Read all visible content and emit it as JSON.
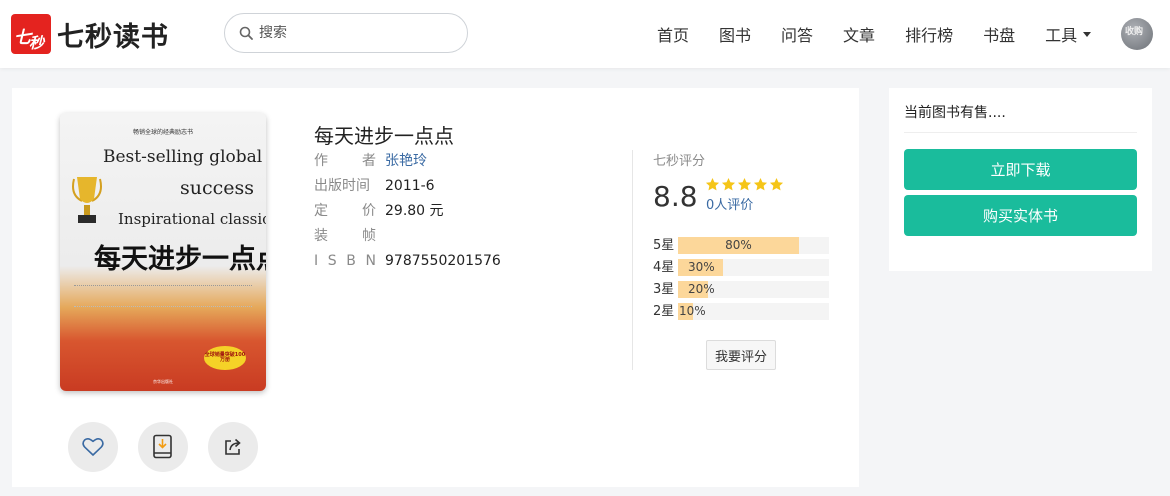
{
  "brand": {
    "logo_mark": "七秒",
    "name": "七秒读书",
    "accent": "#e4231f"
  },
  "search": {
    "placeholder": "搜索",
    "icon": "search-icon"
  },
  "nav": {
    "items": [
      {
        "label": "首页"
      },
      {
        "label": "图书"
      },
      {
        "label": "问答"
      },
      {
        "label": "文章"
      },
      {
        "label": "排行榜"
      },
      {
        "label": "书盘"
      },
      {
        "label": "工具",
        "has_dropdown": true
      }
    ],
    "avatar_text": "收购"
  },
  "book": {
    "title": "每天进步一点点",
    "cover": {
      "series": "畅销全球的经典励志书",
      "en_line1": "Best-selling global",
      "en_line2": "success",
      "en_line3": "Inspirational classic",
      "zh_title": "每天进步一点点",
      "seal": "全球销量突破100万册",
      "publisher": "京华出版社"
    },
    "fields": [
      {
        "key": "作者",
        "value": "张艳玲",
        "link": true
      },
      {
        "key": "出版时间",
        "value": "2011-6",
        "link": false
      },
      {
        "key": "定价",
        "value": "29.80 元",
        "link": false
      },
      {
        "key": "装帧",
        "value": "",
        "link": false
      },
      {
        "key": "ISBN",
        "value": "9787550201576",
        "link": false
      }
    ],
    "actions": [
      {
        "name": "favorite",
        "icon": "heart-icon"
      },
      {
        "name": "download",
        "icon": "book-download-icon"
      },
      {
        "name": "share",
        "icon": "share-icon"
      }
    ]
  },
  "rating": {
    "label": "七秒评分",
    "score": "8.8",
    "stars": 5,
    "count_text": "0人评价",
    "distribution": [
      {
        "label": "5星",
        "percent": 80,
        "text": "80%"
      },
      {
        "label": "4星",
        "percent": 30,
        "text": "30%"
      },
      {
        "label": "3星",
        "percent": 20,
        "text": "20%"
      },
      {
        "label": "2星",
        "percent": 10,
        "text": "10%"
      }
    ],
    "rate_button": "我要评分",
    "star_color": "#f5c518",
    "bar_color": "#fcd79a"
  },
  "sidebar": {
    "title": "当前图书有售....",
    "download_button": "立即下载",
    "buy_button": "购买实体书",
    "button_color": "#1abc9c"
  }
}
